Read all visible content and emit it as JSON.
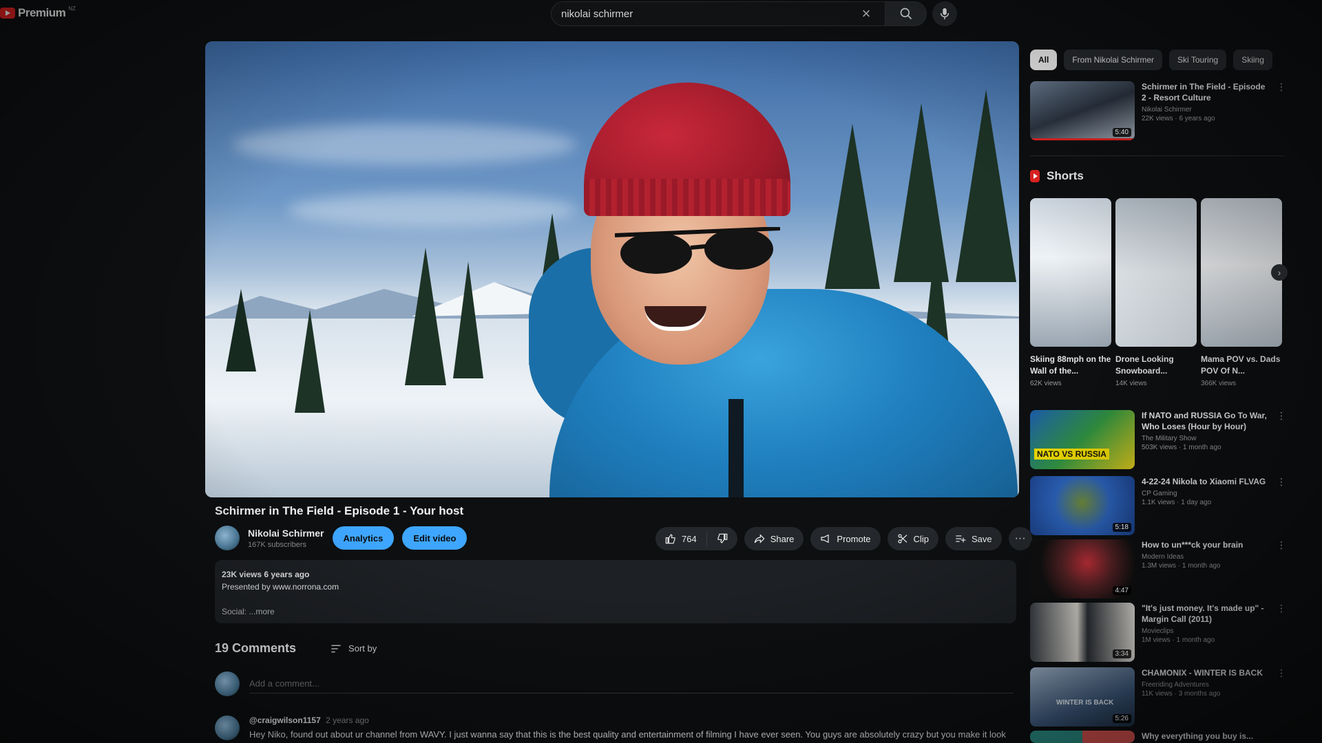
{
  "header": {
    "logo_text": "Premium",
    "logo_superscript": "NZ",
    "search_value": "nikolai schirmer",
    "icons": {
      "clear": "close-icon",
      "search": "search-icon",
      "mic": "mic-icon"
    }
  },
  "video": {
    "title": "Schirmer in The Field - Episode 1 - Your host",
    "channel": "Nikolai Schirmer",
    "subscribers": "167K subscribers",
    "analytics_label": "Analytics",
    "edit_label": "Edit video",
    "likes": "764",
    "share_label": "Share",
    "promote_label": "Promote",
    "clip_label": "Clip",
    "save_label": "Save",
    "more_label": "···"
  },
  "description": {
    "stats": "23K views  6 years ago",
    "line1": "Presented by www.norrona.com",
    "social": "Social:  ...more"
  },
  "comments": {
    "count_label": "19 Comments",
    "sort_label": "Sort by",
    "add_placeholder": "Add a comment...",
    "first": {
      "author": "@craigwilson1157",
      "age": "2 years ago",
      "text": "Hey Niko, found out about ur channel from WAVY. I just wanna say that this is the best quality and entertainment of filming I have ever seen. You guys are absolutely crazy but you make it look"
    }
  },
  "sidebar": {
    "chips": [
      "All",
      "From Nikolai Schirmer",
      "Ski Touring",
      "Skiing"
    ],
    "top_rec": {
      "title": "Schirmer in The Field - Episode 2 - Resort Culture",
      "channel": "Nikolai Schirmer",
      "stats": "22K views · 6 years ago",
      "duration": "5:40",
      "progress": 1.0
    },
    "shorts_title": "Shorts",
    "shorts": [
      {
        "title": "Skiing 88mph on the Wall of the...",
        "views": "62K views"
      },
      {
        "title": "Drone Looking Snowboard...",
        "views": "14K views"
      },
      {
        "title": "Mama POV vs. Dads POV Of N...",
        "views": "366K views"
      }
    ],
    "recs": [
      {
        "title": "If NATO and RUSSIA Go To War, Who Loses (Hour by Hour)",
        "channel": "The Military Show",
        "stats": "503K views · 1 month ago",
        "duration": "",
        "thumb_text": "NATO VS RUSSIA"
      },
      {
        "title": "4-22-24 Nikola to Xiaomi FLVAG",
        "channel": "CP Gaming",
        "stats": "1.1K views · 1 day ago",
        "duration": "5:18",
        "thumb_text": ""
      },
      {
        "title": "How to un***ck your brain",
        "channel": "Modern Ideas",
        "stats": "1.3M views · 1 month ago",
        "duration": "4:47",
        "thumb_text": ""
      },
      {
        "title": "\"It's just money. It's made up\" - Margin Call (2011)",
        "channel": "Movieclips",
        "stats": "1M views · 1 month ago",
        "duration": "3:34",
        "thumb_text": ""
      },
      {
        "title": "CHAMONIX - WINTER IS BACK",
        "channel": "Freeriding Adventures",
        "stats": "11K views · 3 months ago",
        "duration": "5:26",
        "thumb_text": "WINTER IS BACK"
      },
      {
        "title": "Why everything you buy is...",
        "channel": "",
        "stats": "",
        "duration": "",
        "thumb_text": ""
      }
    ]
  },
  "colors": {
    "accent_blue": "#3ea6ff",
    "brand_red": "#e32322",
    "background": "#0d0f11"
  }
}
